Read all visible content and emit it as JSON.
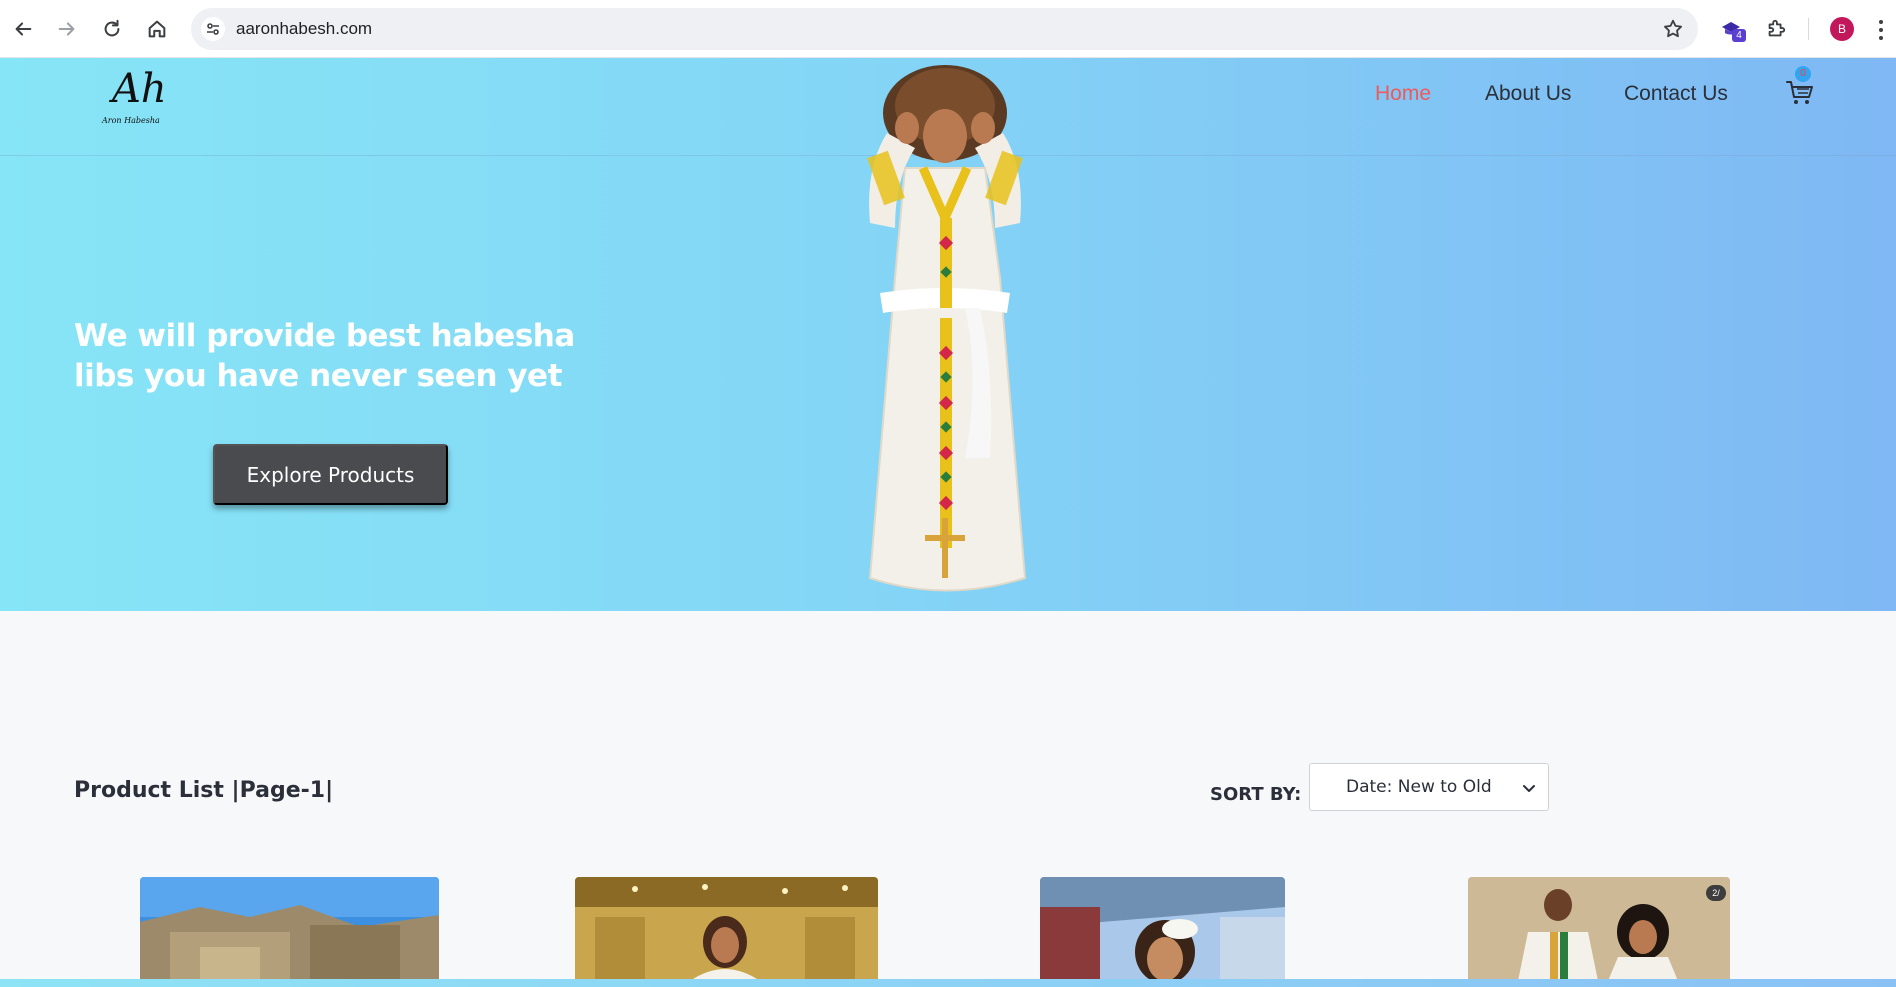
{
  "browser": {
    "url": "aaronhabesh.com",
    "extension_badge": "4",
    "profile_initial": "B",
    "icons": [
      "back-icon",
      "forward-icon",
      "reload-icon",
      "home-icon",
      "site-info-icon",
      "bookmark-star-icon",
      "extension-icon",
      "puzzle-icon",
      "more-icon"
    ]
  },
  "site": {
    "logo_mark": "Ah",
    "logo_text": "Aron Habesha",
    "nav": [
      {
        "label": "Home",
        "active": true
      },
      {
        "label": "About Us",
        "active": false
      },
      {
        "label": "Contact Us",
        "active": false
      }
    ],
    "cart_count": "0",
    "accent_color": "#ee5a5a"
  },
  "hero": {
    "title": "We will provide best habesha libs you have never seen yet",
    "cta_label": "Explore Products"
  },
  "products": {
    "list_title": "Product List |Page-1|",
    "sort_label": "SORT BY:",
    "sort_value": "Date: New to Old",
    "carousel_indicator": "2/"
  }
}
